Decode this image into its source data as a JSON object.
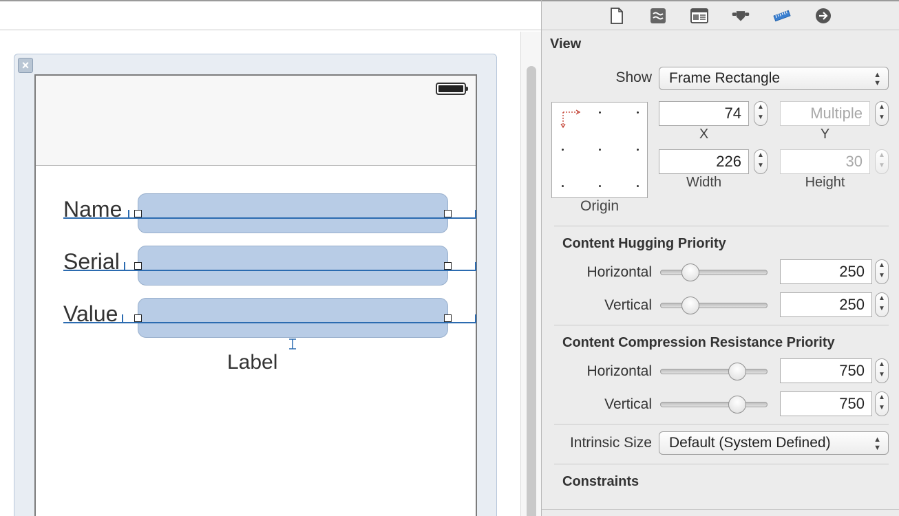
{
  "canvas": {
    "labels": [
      "Name",
      "Serial",
      "Value"
    ],
    "bottom_label": "Label"
  },
  "inspector": {
    "tabs": [
      {
        "name": "file-inspector-icon"
      },
      {
        "name": "quick-help-icon"
      },
      {
        "name": "identity-inspector-icon"
      },
      {
        "name": "attributes-inspector-icon"
      },
      {
        "name": "size-inspector-icon",
        "active": true
      },
      {
        "name": "connections-inspector-icon"
      }
    ],
    "accent_color": "#2d6fb8",
    "section_title": "View",
    "show": {
      "label": "Show",
      "value": "Frame Rectangle"
    },
    "origin_label": "Origin",
    "x": {
      "label": "X",
      "value": "74"
    },
    "y": {
      "label": "Y",
      "placeholder": "Multiple"
    },
    "width": {
      "label": "Width",
      "value": "226"
    },
    "height": {
      "label": "Height",
      "value": "30"
    },
    "hugging": {
      "title": "Content Hugging Priority",
      "horizontal": {
        "label": "Horizontal",
        "value": "250"
      },
      "vertical": {
        "label": "Vertical",
        "value": "250"
      }
    },
    "compression": {
      "title": "Content Compression Resistance Priority",
      "horizontal": {
        "label": "Horizontal",
        "value": "750"
      },
      "vertical": {
        "label": "Vertical",
        "value": "750"
      }
    },
    "intrinsic": {
      "label": "Intrinsic Size",
      "value": "Default (System Defined)"
    },
    "constraints_title": "Constraints"
  }
}
